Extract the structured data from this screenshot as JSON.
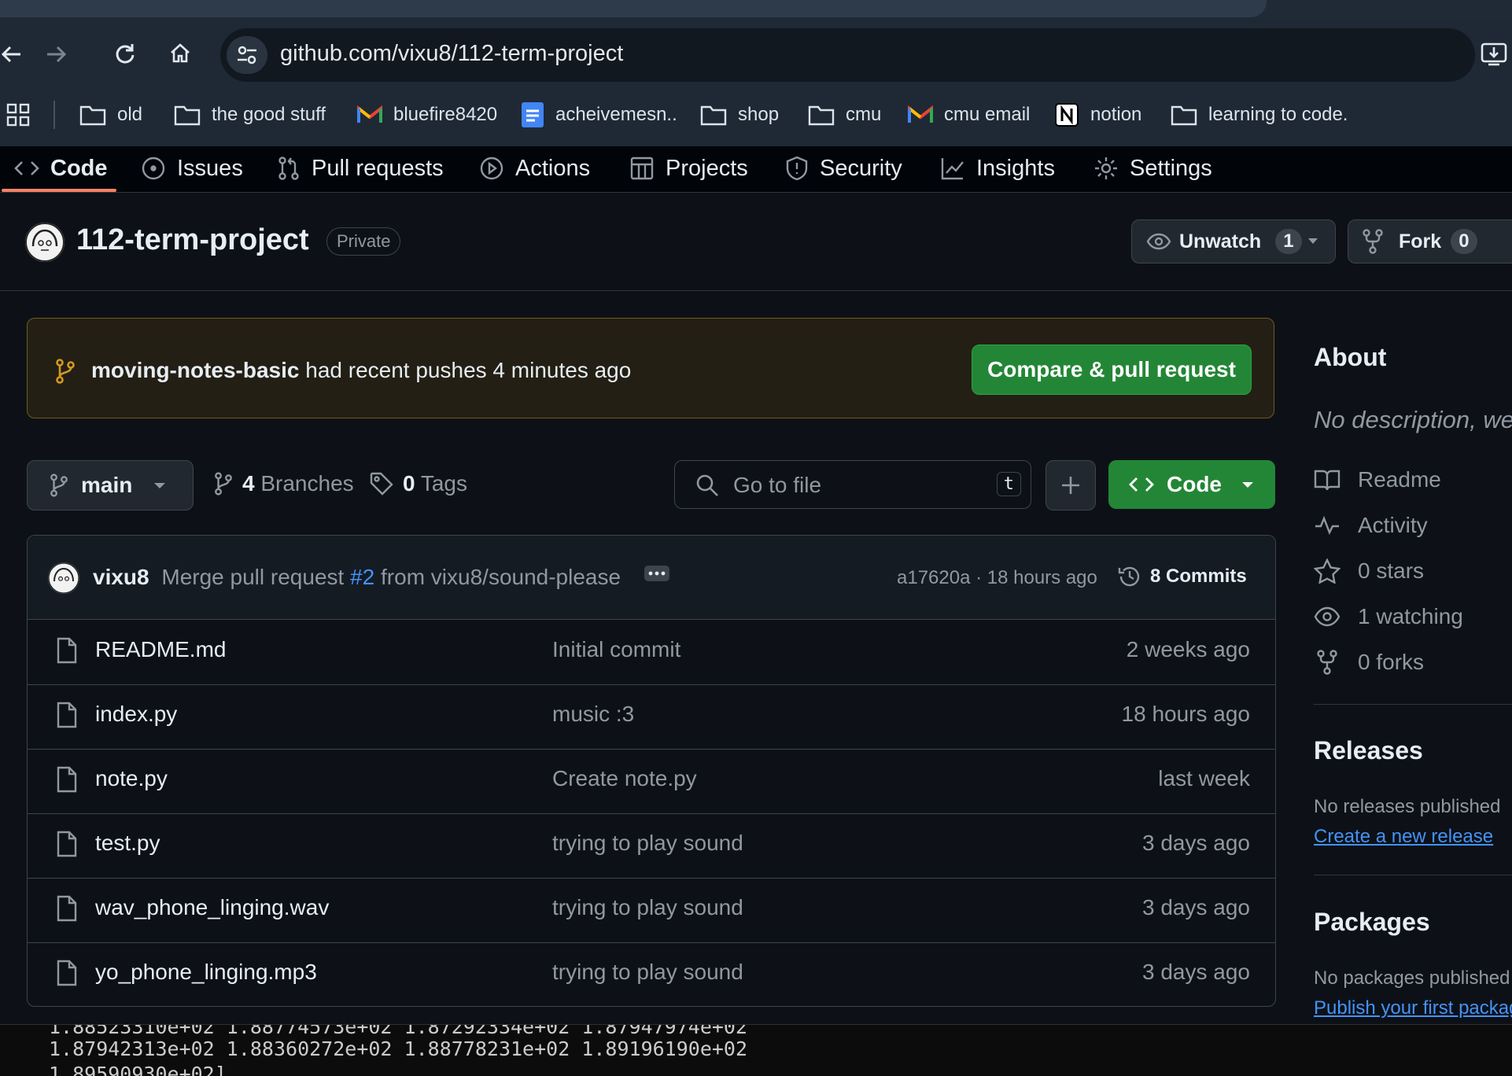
{
  "browser": {
    "url": "github.com/vixu8/112-term-project",
    "bookmarks": [
      {
        "label": "old",
        "icon": "folder-icon"
      },
      {
        "label": "the good stuff",
        "icon": "folder-icon"
      },
      {
        "label": "bluefire8420",
        "icon": "gmail-icon"
      },
      {
        "label": "acheivemesn..",
        "icon": "docs-icon"
      },
      {
        "label": "shop",
        "icon": "folder-icon"
      },
      {
        "label": "cmu",
        "icon": "folder-icon"
      },
      {
        "label": "cmu email",
        "icon": "gmail-icon"
      },
      {
        "label": "notion",
        "icon": "notion-icon"
      },
      {
        "label": "learning to code.",
        "icon": "folder-icon"
      }
    ]
  },
  "repo_nav": {
    "tabs": [
      {
        "label": "Code",
        "icon": "code-icon",
        "active": true
      },
      {
        "label": "Issues",
        "icon": "issue-icon"
      },
      {
        "label": "Pull requests",
        "icon": "pull-request-icon"
      },
      {
        "label": "Actions",
        "icon": "play-icon"
      },
      {
        "label": "Projects",
        "icon": "table-icon"
      },
      {
        "label": "Security",
        "icon": "shield-icon"
      },
      {
        "label": "Insights",
        "icon": "graph-icon"
      },
      {
        "label": "Settings",
        "icon": "gear-icon"
      }
    ]
  },
  "repo": {
    "name": "112-term-project",
    "visibility": "Private",
    "unwatch_label": "Unwatch",
    "watch_count": "1",
    "fork_label": "Fork",
    "fork_count": "0"
  },
  "banner": {
    "branch": "moving-notes-basic",
    "message": "had recent pushes 4 minutes ago",
    "button": "Compare & pull request"
  },
  "file_nav": {
    "branch": "main",
    "branches_count": "4",
    "branches_label": "Branches",
    "tags_count": "0",
    "tags_label": "Tags",
    "search_placeholder": "Go to file",
    "search_shortcut": "t",
    "code_button": "Code"
  },
  "latest_commit": {
    "author": "vixu8",
    "message_prefix": "Merge pull request",
    "pr_link": "#2",
    "message_suffix": "from vixu8/sound-please",
    "meta": "a17620a · 18 hours ago",
    "commits_label": "8 Commits"
  },
  "files": [
    {
      "name": "README.md",
      "message": "Initial commit",
      "date": "2 weeks ago"
    },
    {
      "name": "index.py",
      "message": "music :3",
      "date": "18 hours ago"
    },
    {
      "name": "note.py",
      "message": "Create note.py",
      "date": "last week"
    },
    {
      "name": "test.py",
      "message": "trying to play sound",
      "date": "3 days ago"
    },
    {
      "name": "wav_phone_linging.wav",
      "message": "trying to play sound",
      "date": "3 days ago"
    },
    {
      "name": "yo_phone_linging.mp3",
      "message": "trying to play sound",
      "date": "3 days ago"
    }
  ],
  "about": {
    "heading": "About",
    "description": "No description, we",
    "items": [
      {
        "label": "Readme",
        "icon": "book-icon"
      },
      {
        "label": "Activity",
        "icon": "pulse-icon"
      },
      {
        "label": "0 stars",
        "icon": "star-icon"
      },
      {
        "label": "1 watching",
        "icon": "eye-icon"
      },
      {
        "label": "0 forks",
        "icon": "fork-icon"
      }
    ]
  },
  "releases": {
    "heading": "Releases",
    "text": "No releases published",
    "link": "Create a new release"
  },
  "packages": {
    "heading": "Packages",
    "text": "No packages published",
    "link": "Publish your first packag"
  },
  "terminal": {
    "line1": "1.88523310e+02 1.88774573e+02 1.87292334e+02 1.87947974e+02",
    "line2": "1.87942313e+02 1.88360272e+02 1.88778231e+02 1.89196190e+02",
    "line3": "1.89590930e+02]"
  },
  "colors": {
    "accent_green": "#238636",
    "link_blue": "#4493f8",
    "banner_bg": "#241f14",
    "underline": "#f78166"
  }
}
